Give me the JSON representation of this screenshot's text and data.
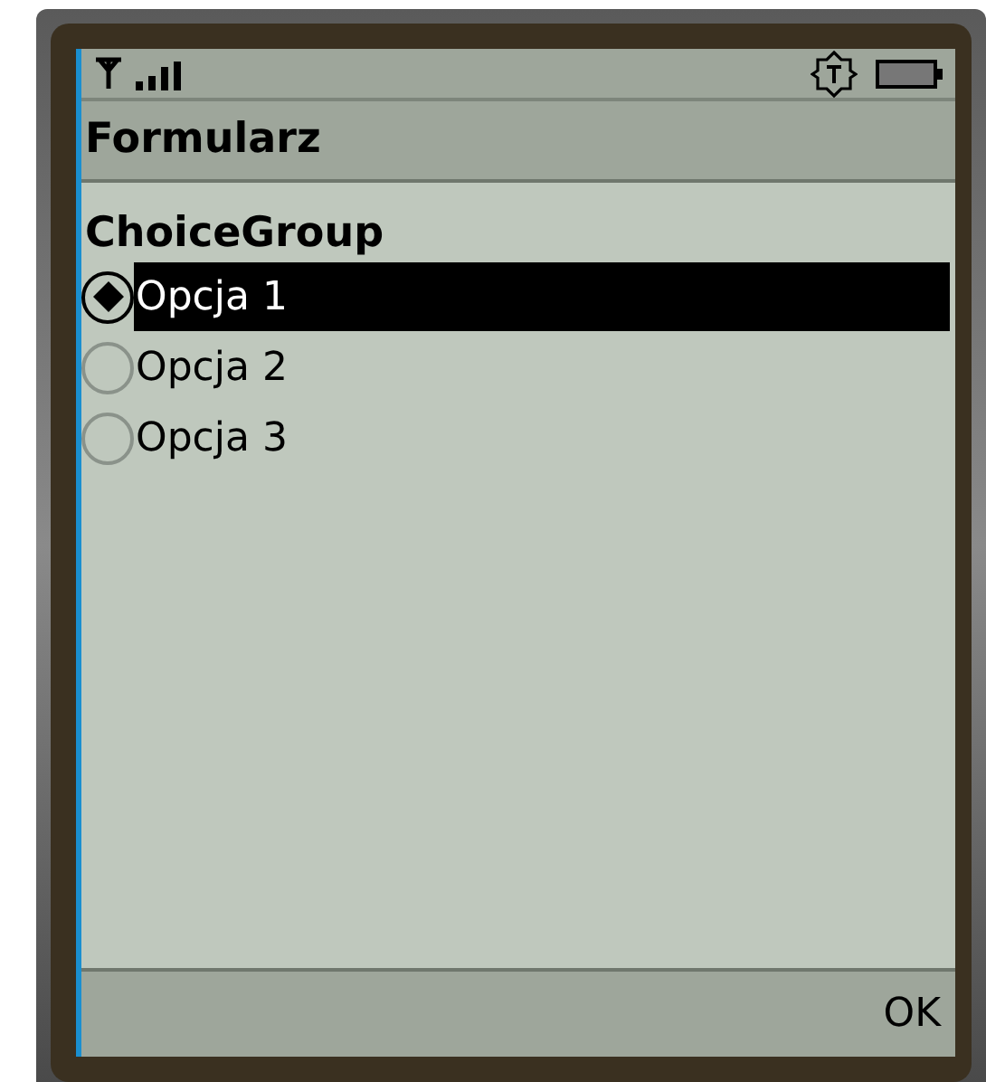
{
  "title": "Formularz",
  "group": {
    "label": "ChoiceGroup",
    "options": [
      {
        "label": "Opcja 1",
        "selected": true,
        "focused": true
      },
      {
        "label": "Opcja 2",
        "selected": false,
        "focused": false
      },
      {
        "label": "Opcja 3",
        "selected": false,
        "focused": false
      }
    ]
  },
  "softkey": "OK"
}
